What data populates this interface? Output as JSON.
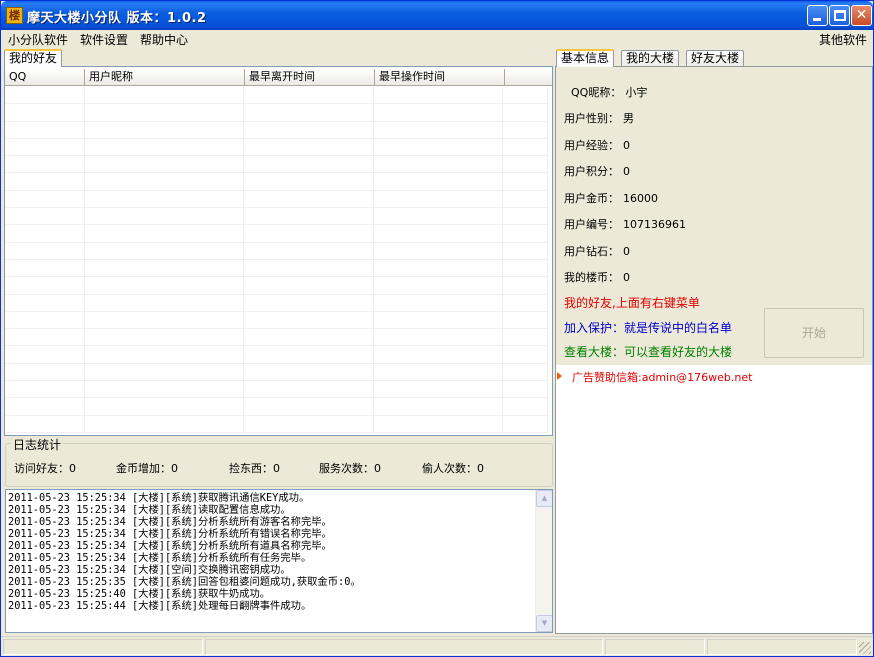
{
  "window": {
    "icon_glyph": "楼",
    "title": "摩天大楼小分队 版本：1.0.2",
    "minimize_icon": "minimize-icon",
    "maximize_icon": "maximize-icon",
    "close_glyph": "✕"
  },
  "menu": {
    "items": [
      "小分队软件",
      "软件设置",
      "帮助中心"
    ],
    "right_item": "其他软件"
  },
  "friends": {
    "tab_label": "我的好友",
    "columns": [
      "QQ",
      "用户昵称",
      "最早离开时间",
      "最早操作时间"
    ]
  },
  "stats": {
    "legend": "日志统计",
    "items": [
      {
        "label": "访问好友：",
        "value": "0"
      },
      {
        "label": "金币增加：",
        "value": "0"
      },
      {
        "label": "捡东西：",
        "value": "0"
      },
      {
        "label": "服务次数：",
        "value": "0"
      },
      {
        "label": "偷人次数：",
        "value": "0"
      }
    ]
  },
  "log": {
    "lines": [
      "2011-05-23 15:25:34 [大楼][系统]获取腾讯通信KEY成功。",
      "2011-05-23 15:25:34 [大楼][系统]读取配置信息成功。",
      "2011-05-23 15:25:34 [大楼][系统]分析系统所有游客名称完毕。",
      "2011-05-23 15:25:34 [大楼][系统]分析系统所有错误名称完毕。",
      "2011-05-23 15:25:34 [大楼][系统]分析系统所有道具名称完毕。",
      "2011-05-23 15:25:34 [大楼][系统]分析系统所有任务完毕。",
      "2011-05-23 15:25:34 [大楼][空间]交换腾讯密钥成功。",
      "2011-05-23 15:25:35 [大楼][系统]回答包租婆问题成功,获取金币:0。",
      "2011-05-23 15:25:40 [大楼][系统]获取牛奶成功。",
      "2011-05-23 15:25:44 [大楼][系统]处理每日翻牌事件成功。"
    ]
  },
  "right_tabs": [
    "基本信息",
    "我的大楼",
    "好友大楼"
  ],
  "basic_info": [
    {
      "label": "QQ昵称：",
      "value": "小宇"
    },
    {
      "label": "用户性别：",
      "value": "男"
    },
    {
      "label": "用户经验：",
      "value": "0"
    },
    {
      "label": "用户积分：",
      "value": "0"
    },
    {
      "label": "用户金币：",
      "value": "16000"
    },
    {
      "label": "用户编号：",
      "value": "107136961"
    },
    {
      "label": "用户钻石：",
      "value": "0"
    },
    {
      "label": "我的楼币：",
      "value": "0"
    }
  ],
  "links": {
    "friends_hint": "我的好友,上面有右键菜单",
    "protect_hint": "加入保护：就是传说中的白名单",
    "view_hint": "查看大楼：可以查看好友的大楼"
  },
  "start_button": "开始",
  "ad": {
    "text": "广告赞助信箱:admin@176web.net"
  },
  "colors": {
    "friends_hint": "#e00000",
    "protect_hint": "#0000c8",
    "view_hint": "#008000",
    "ad_text": "#e00000"
  }
}
